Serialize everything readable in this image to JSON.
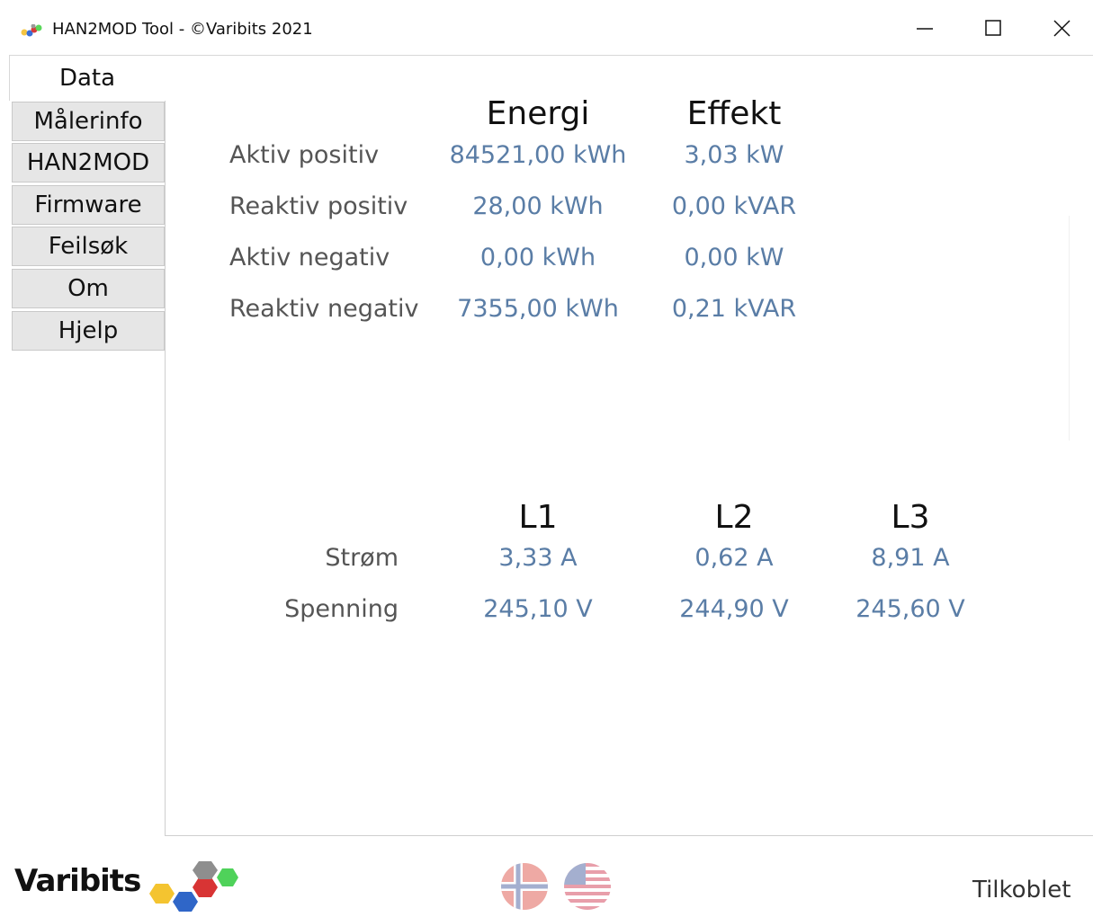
{
  "window": {
    "title": "HAN2MOD Tool - ©Varibits 2021",
    "icons": [
      "app-icon",
      "minimize-icon",
      "maximize-icon",
      "close-icon"
    ]
  },
  "tabs": {
    "active": "Data",
    "items": [
      "Målerinfo",
      "HAN2MOD",
      "Firmware",
      "Feilsøk",
      "Om",
      "Hjelp"
    ]
  },
  "energy": {
    "col_energy": "Energi",
    "col_power": "Effekt",
    "rows": [
      {
        "label": "Aktiv positiv",
        "energy": "84521,00 kWh",
        "power": "3,03 kW"
      },
      {
        "label": "Reaktiv positiv",
        "energy": "28,00 kWh",
        "power": "0,00 kVAR"
      },
      {
        "label": "Aktiv negativ",
        "energy": "0,00 kWh",
        "power": "0,00 kW"
      },
      {
        "label": "Reaktiv negativ",
        "energy": "7355,00 kWh",
        "power": "0,21 kVAR"
      }
    ]
  },
  "phases": {
    "headers": [
      "L1",
      "L2",
      "L3"
    ],
    "rows": [
      {
        "label": "Strøm",
        "values": [
          "3,33 A",
          "0,62 A",
          "8,91 A"
        ]
      },
      {
        "label": "Spenning",
        "values": [
          "245,10 V",
          "244,90 V",
          "245,60 V"
        ]
      }
    ]
  },
  "footer": {
    "logo": "Varibits",
    "status": "Tilkoblet",
    "language_flags": [
      "norway-flag-icon",
      "usa-flag-icon"
    ]
  },
  "colors": {
    "value_text": "#5a7da6",
    "label_text": "#555555",
    "tab_bg": "#e6e6e6"
  }
}
